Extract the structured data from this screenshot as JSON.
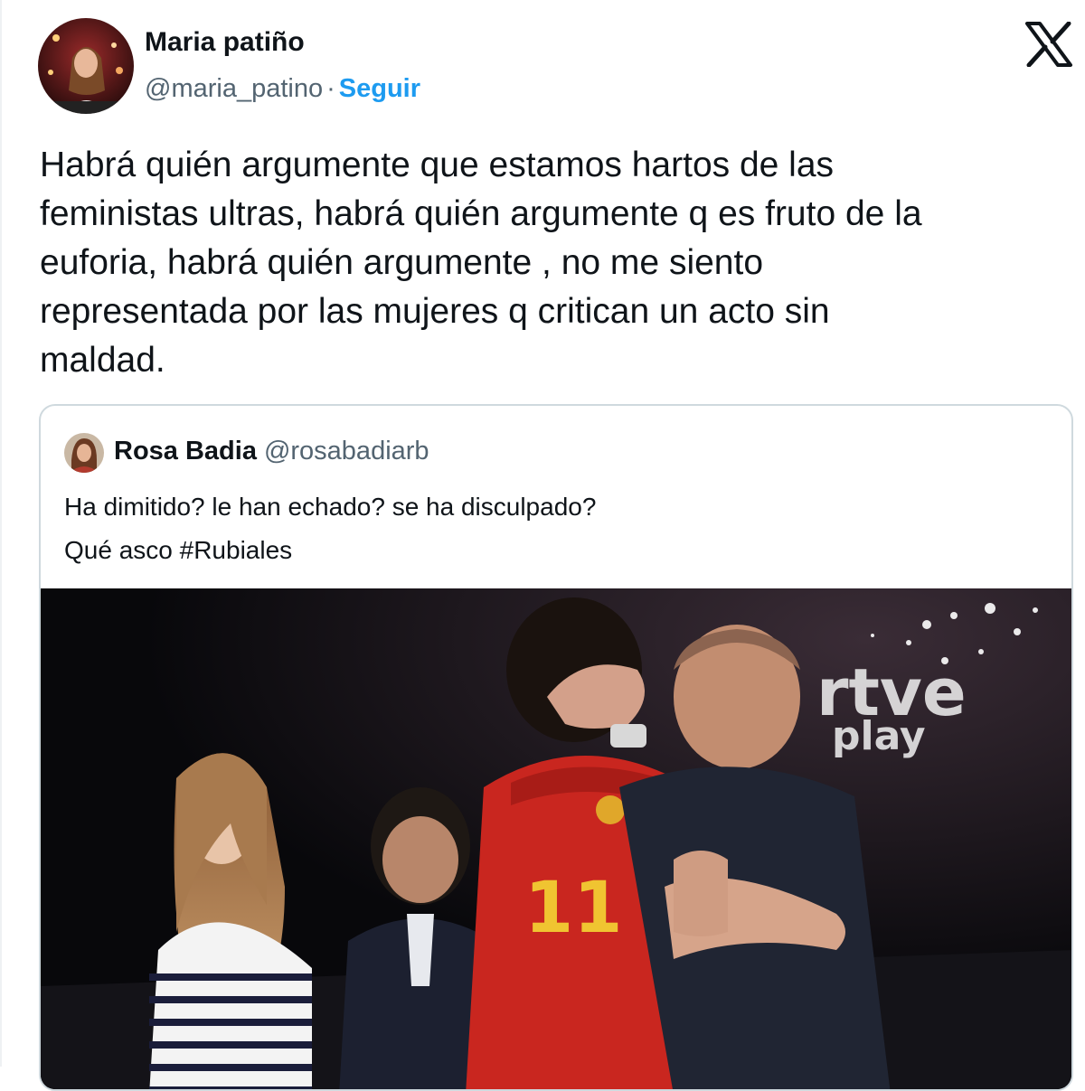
{
  "tweet": {
    "author_name": "Maria patiño",
    "author_handle": "@maria_patino",
    "separator": "·",
    "follow_label": "Seguir",
    "text_lines": [
      "Habrá quién argumente que estamos hartos de las",
      "feministas ultras, habrá quién argumente q es fruto de la",
      "euforia, habrá quién argumente , no me siento",
      "representada por las mujeres q critican un acto sin",
      "maldad."
    ]
  },
  "quoted_tweet": {
    "author_name": "Rosa Badia",
    "author_handle": "@rosabadiarb",
    "text_lines": [
      "Ha dimitido? le han echado? se ha disculpado?",
      "Qué asco #Rubiales"
    ],
    "media": {
      "watermark_line1": "rtve",
      "watermark_line2": "play",
      "jersey_number": "11"
    }
  },
  "icons": {
    "brand": "x-logo-icon"
  },
  "colors": {
    "accent": "#1d9bf0",
    "text": "#0f1419",
    "secondary": "#536471",
    "border": "#cfd9de"
  }
}
